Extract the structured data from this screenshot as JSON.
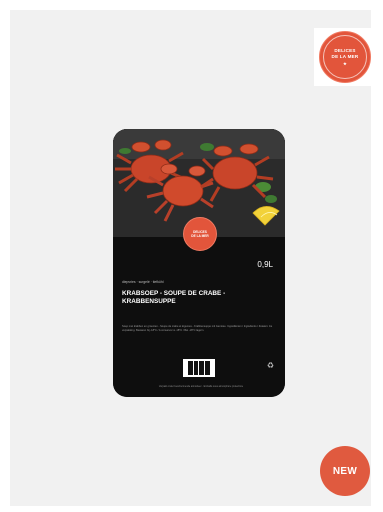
{
  "brand_badge": {
    "line1": "DELICES",
    "line2": "DE LA MER",
    "mark": "★"
  },
  "product": {
    "seal_line1": "DELICES",
    "seal_line2": "DE LA MER",
    "volume": "0,9L",
    "subtitle": "diepvries · surgelé · tiefkühl",
    "title": "KRABSOEP - SOUPE DE CRABE - KRABBENSUPPE",
    "fine_print": "Soep met krabben en groenten - Soupe de crabe et légumes - Krabbensuppe mit Gemüse. Ingrediënten / Ingrédients / Zutaten: zie verpakking. Bewaren bij -18°C / A conserver à -18°C / Bei -18°C lagern.",
    "recycle_icon": "♻",
    "footer": "Verpakt onder beschermende atmosfeer · Emballé sous atmosphère protectrice"
  },
  "new_badge": {
    "label": "NEW"
  },
  "colors": {
    "background": "#f1f1f1",
    "brand_red": "#e2553b",
    "package_black": "#111111"
  }
}
